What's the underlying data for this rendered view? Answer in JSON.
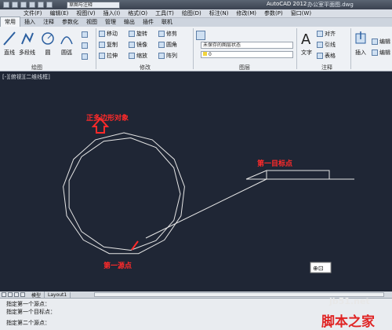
{
  "titlebar": {
    "workspace": "草图与注释",
    "app_title": "AutoCAD 2012",
    "file_title": "办公室平面图.dwg"
  },
  "menubar": {
    "items": [
      "文件(F)",
      "编辑(E)",
      "视图(V)",
      "插入(I)",
      "格式(O)",
      "工具(T)",
      "绘图(D)",
      "标注(N)",
      "修改(M)",
      "参数(P)",
      "窗口(W)"
    ]
  },
  "ribbon_tabs": [
    "常用",
    "插入",
    "注释",
    "参数化",
    "视图",
    "管理",
    "输出",
    "插件",
    "联机"
  ],
  "ribbon": {
    "draw": {
      "line": "直线",
      "polyline": "多段线",
      "circle": "圆",
      "arc": "圆弧",
      "panel_label": "绘图"
    },
    "modify": {
      "move": "移动",
      "rotate": "旋转",
      "trim": "修剪",
      "copy": "复制",
      "mirror": "镜像",
      "fillet": "圆角",
      "stretch": "拉伸",
      "scale": "缩放",
      "array": "阵列",
      "panel_label": "修改"
    },
    "layers": {
      "layer_state": "未保存的图层状态",
      "layer_value": "0",
      "panel_label": "图层"
    },
    "annotation": {
      "text": "文字",
      "align": "对齐",
      "leader": "引线",
      "table": "表格",
      "panel_label": "注释"
    },
    "block": {
      "insert": "插入",
      "edit": "编辑",
      "edit2": "编辑"
    }
  },
  "viewport": {
    "label": "[-][俯视][二维线框]"
  },
  "annotations": {
    "polygon_object": "正多边形对象",
    "first_target_point": "第一目标点",
    "first_source_point": "第一源点"
  },
  "layout_tabs": [
    "模型",
    "Layout1"
  ],
  "cmdline": {
    "lines": [
      "指定第一个源点：",
      "指定第一个目标点：",
      "指定第二个源点："
    ]
  },
  "watermark": {
    "site": "jb51.net",
    "brand": "脚本之家"
  },
  "colors": {
    "viewport_bg": "#1f2635",
    "annotation_red": "#ff2a2a",
    "geometry_white": "#e6e6e6"
  }
}
